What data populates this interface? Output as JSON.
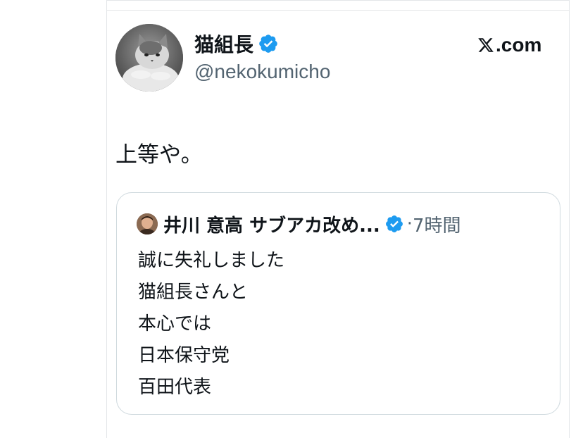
{
  "author": {
    "display_name": "猫組長",
    "handle": "@nekokumicho",
    "avatar_icon": "cat-avatar",
    "verified_icon": "verified-badge-icon"
  },
  "brand": {
    "logo_icon": "x-logo-icon",
    "suffix": ".com"
  },
  "tweet": {
    "text": "上等や。"
  },
  "quote": {
    "avatar_icon": "person-avatar",
    "display_name": "井川 意高 サブアカ改め...",
    "separator": "·",
    "time": "7時間",
    "lines": [
      "誠に失礼しました",
      "猫組長さんと",
      "本心では",
      "日本保守党",
      "百田代表"
    ]
  },
  "colors": {
    "verified_blue": "#1d9bf0",
    "secondary_text": "#536471",
    "primary_text": "#0f1419",
    "border": "#cfd9de"
  }
}
